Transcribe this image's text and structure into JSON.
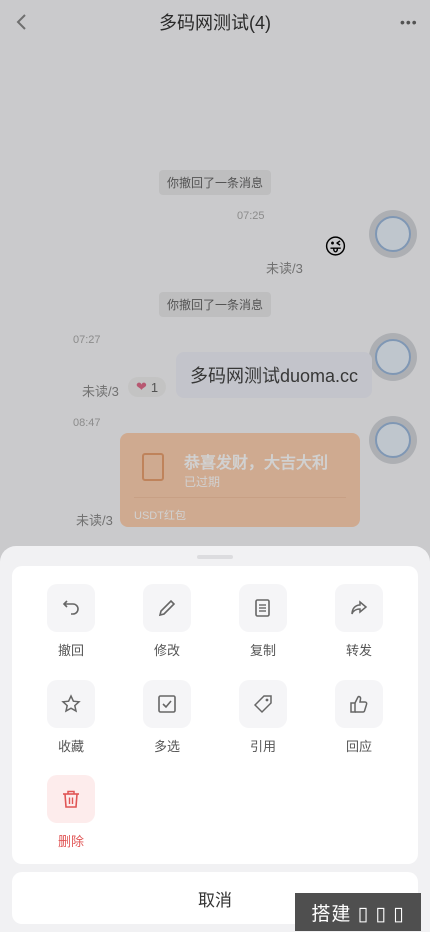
{
  "header": {
    "title": "多码网测试(4)",
    "more_label": "•••"
  },
  "chat": {
    "system_msg_1": "你撤回了一条消息",
    "time_1": "07:25",
    "unread_1": "未读/3",
    "emoji_1": "😜",
    "system_msg_2": "你撤回了一条消息",
    "time_2": "07:27",
    "unread_2": "未读/3",
    "bubble_text": "多码网测试duoma.cc",
    "reaction_emoji": "❤",
    "reaction_count": "1",
    "time_3": "08:47",
    "unread_3": "未读/3",
    "redpacket": {
      "title": "恭喜发财，大吉大利",
      "status": "已过期",
      "type": "USDT红包"
    }
  },
  "sheet": {
    "actions": [
      {
        "label": "撤回",
        "icon": "undo-icon"
      },
      {
        "label": "修改",
        "icon": "pencil-icon"
      },
      {
        "label": "复制",
        "icon": "copy-icon"
      },
      {
        "label": "转发",
        "icon": "forward-icon"
      },
      {
        "label": "收藏",
        "icon": "star-icon"
      },
      {
        "label": "多选",
        "icon": "checkbox-icon"
      },
      {
        "label": "引用",
        "icon": "tag-icon"
      },
      {
        "label": "回应",
        "icon": "thumbs-up-icon"
      },
      {
        "label": "删除",
        "icon": "trash-icon"
      }
    ],
    "cancel_label": "取消"
  },
  "watermark": "搭建 ▯ ▯ ▯",
  "colors": {
    "danger": "#e05555",
    "sheet_bg": "#f1f1f3",
    "redpacket": "#fdd0b0"
  }
}
